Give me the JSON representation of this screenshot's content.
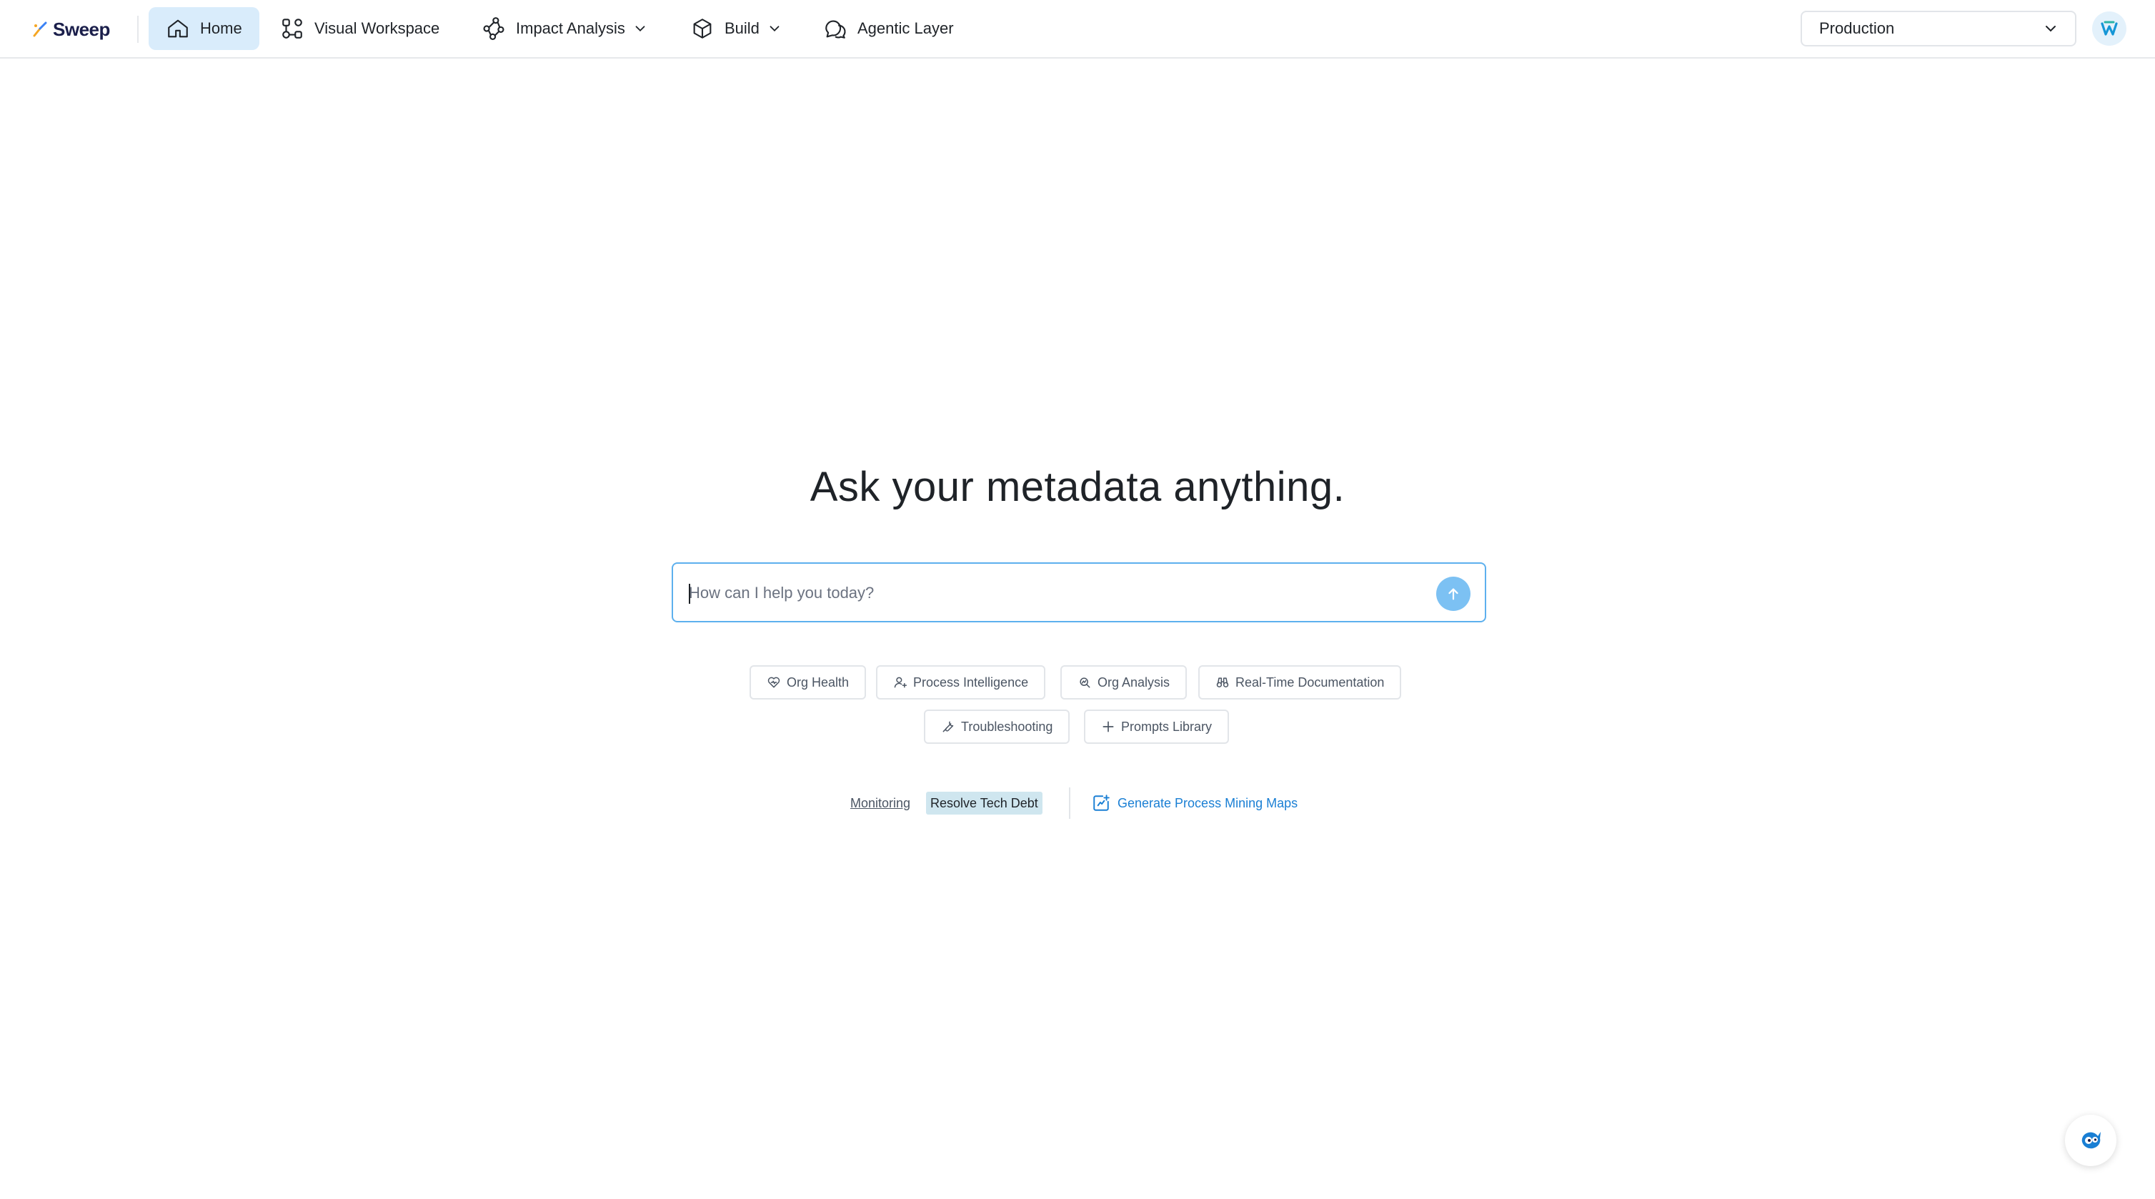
{
  "brand": {
    "name": "Sweep"
  },
  "nav": {
    "items": [
      {
        "label": "Home",
        "icon": "home-icon",
        "active": true
      },
      {
        "label": "Visual Workspace",
        "icon": "workflow-icon"
      },
      {
        "label": "Impact Analysis",
        "icon": "graph-nodes-icon",
        "dropdown": true
      },
      {
        "label": "Build",
        "icon": "cube-icon",
        "dropdown": true
      },
      {
        "label": "Agentic Layer",
        "icon": "chat-bubbles-icon"
      }
    ]
  },
  "environment": {
    "selected": "Production"
  },
  "hero": {
    "title": "Ask your metadata anything."
  },
  "prompt": {
    "placeholder": "How can I help you today?"
  },
  "chips": [
    {
      "label": "Org Health",
      "icon": "heart-icon"
    },
    {
      "label": "Process Intelligence",
      "icon": "user-sparkle-icon"
    },
    {
      "label": "Org Analysis",
      "icon": "analysis-icon"
    },
    {
      "label": "Real-Time Documentation",
      "icon": "binoculars-icon"
    },
    {
      "label": "Troubleshooting",
      "icon": "wrench-icon"
    },
    {
      "label": "Prompts Library",
      "icon": "plus-icon"
    }
  ],
  "footer_links": {
    "monitoring": "Monitoring",
    "resolve_tech_debt": "Resolve Tech Debt",
    "generate_maps": "Generate Process Mining Maps"
  },
  "colors": {
    "accent": "#1a7fd4",
    "active_nav_bg": "#d9ecfb",
    "input_border": "#5db0ee",
    "send_button": "#7cc1f3",
    "tech_debt_highlight": "#cfe6ef"
  }
}
